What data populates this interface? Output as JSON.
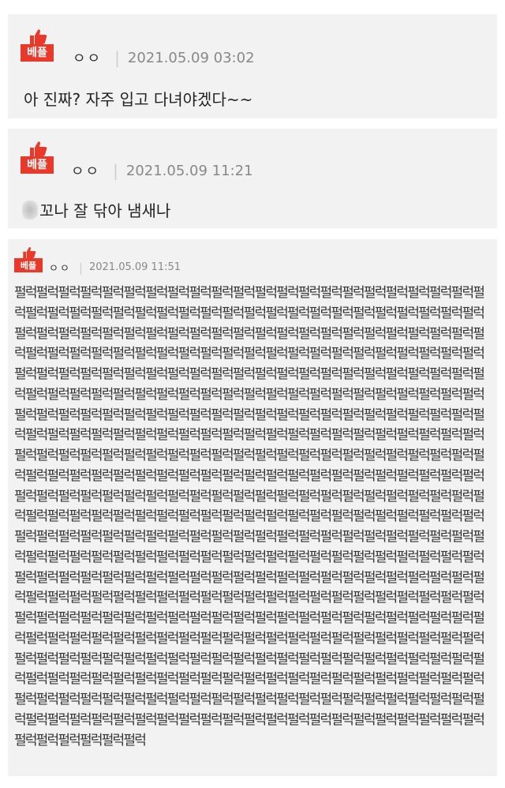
{
  "badge_label": "베플",
  "comments": [
    {
      "author": "ㅇㅇ",
      "date": "2021.05.09 03:02",
      "text": "아 진짜? 자주 입고 다녀야겠다~~"
    },
    {
      "author": "ㅇㅇ",
      "date": "2021.05.09 11:21",
      "text": "꼬나 잘 닦아 냄새나"
    },
    {
      "author": "ㅇㅇ",
      "date": "2021.05.09 11:51",
      "text": "펄럭펄럭펄럭펄럭펄럭펄럭펄럭펄럭펄럭펄럭펄럭펄럭펄럭펄럭펄럭펄럭펄럭펄럭펄럭펄럭펄럭펄럭펄럭펄럭펄럭펄럭펄럭펄럭펄럭펄럭펄럭펄럭펄럭펄럭펄럭펄럭펄럭펄럭펄럭펄럭펄럭펄럭펄럭펄럭펄럭펄럭펄럭펄럭펄럭펄럭펄럭펄럭펄럭펄럭펄럭펄럭펄럭펄럭펄럭펄럭펄럭펄럭펄럭펄럭펄럭펄럭펄럭펄럭펄럭펄럭펄럭펄럭펄럭펄럭펄럭펄럭펄럭펄럭펄럭펄럭펄럭펄럭펄럭펄럭펄럭펄럭펄럭펄럭펄럭펄럭펄럭펄럭펄럭펄럭펄럭펄럭펄럭펄럭펄럭펄럭펄럭펄럭펄럭펄럭펄럭펄럭펄럭펄럭펄럭펄럭펄럭펄럭펄럭펄럭펄럭펄럭펄럭펄럭펄럭펄럭펄럭펄럭펄럭펄럭펄럭펄럭펄럭펄럭펄럭펄럭펄럭펄럭펄럭펄럭펄럭펄럭펄럭펄럭펄럭펄럭펄럭펄럭펄럭펄럭펄럭펄럭펄럭펄럭펄럭펄럭펄럭펄럭펄럭펄럭펄럭펄럭펄럭펄럭펄럭펄럭펄럭펄럭펄럭펄럭펄럭펄럭펄럭펄럭펄럭펄럭펄럭펄럭펄럭펄럭펄럭펄럭펄럭펄럭펄럭펄럭펄럭펄럭펄럭펄럭펄럭펄럭펄럭펄럭펄럭펄럭펄럭펄럭펄럭펄럭펄럭펄럭펄럭펄럭펄럭펄럭펄럭펄럭펄럭펄럭펄럭펄럭펄럭펄럭펄럭펄럭펄럭펄럭펄럭펄럭펄럭펄럭펄럭펄럭펄럭펄럭펄럭펄럭펄럭펄럭펄럭펄럭펄럭펄럭펄럭펄럭펄럭펄럭펄럭펄럭펄럭펄럭펄럭펄럭펄럭펄럭펄럭펄럭펄럭펄럭펄럭펄럭펄럭펄럭펄럭펄럭펄럭펄럭펄럭펄럭펄럭펄럭펄럭펄럭펄럭펄럭펄럭펄럭펄럭펄럭펄럭펄럭펄럭펄럭펄럭펄럭펄럭펄럭펄럭펄럭펄럭펄럭펄럭펄럭펄럭펄럭펄럭펄럭펄럭펄럭펄럭펄럭펄럭펄럭펄럭펄럭펄럭펄럭펄럭펄럭펄럭펄럭펄럭펄럭펄럭펄럭펄럭펄럭펄럭펄럭펄럭펄럭펄럭펄럭펄럭펄럭펄럭펄럭펄럭펄럭펄럭펄럭펄럭펄럭펄럭펄럭펄럭펄럭펄럭펄럭펄럭펄럭펄럭펄럭펄럭펄럭펄럭펄럭펄럭펄럭펄럭펄럭펄럭펄럭펄럭펄럭펄럭펄럭펄럭펄럭펄럭펄럭펄럭펄럭펄럭펄럭펄럭펄럭펄럭펄럭펄럭펄럭펄럭펄럭펄럭펄럭펄럭펄럭펄럭펄럭펄럭펄럭펄럭펄럭펄럭펄럭펄럭펄럭펄럭펄럭펄럭펄럭펄럭펄럭펄럭펄럭펄럭펄럭펄럭펄럭펄럭펄럭펄럭펄럭펄럭펄럭펄럭펄럭펄럭펄럭펄럭펄럭펄럭펄럭펄럭펄럭펄럭펄럭펄럭펄럭펄럭펄럭펄럭펄럭펄럭펄럭펄럭펄럭펄럭펄럭펄럭펄럭펄럭펄럭펄럭펄럭펄럭펄럭펄럭펄럭펄럭펄럭펄럭펄럭펄럭펄럭펄럭펄럭펄럭펄럭펄럭펄럭펄럭펄럭펄럭펄럭펄럭펄럭펄럭펄럭펄럭펄럭펄럭펄럭펄럭펄럭펄럭펄럭펄럭펄럭펄럭펄럭펄럭펄럭펄럭펄럭펄럭펄럭펄럭펄럭펄럭펄럭펄럭펄럭펄럭펄럭펄럭펄럭펄럭펄럭펄럭펄럭펄럭펄럭펄럭"
    }
  ],
  "colors": {
    "badge": "#e8392a",
    "card_bg": "#f2f2f2",
    "date": "#888888"
  },
  "icons": {
    "badge_icon": "thumbs-up-icon",
    "redaction": "blurred-character"
  }
}
